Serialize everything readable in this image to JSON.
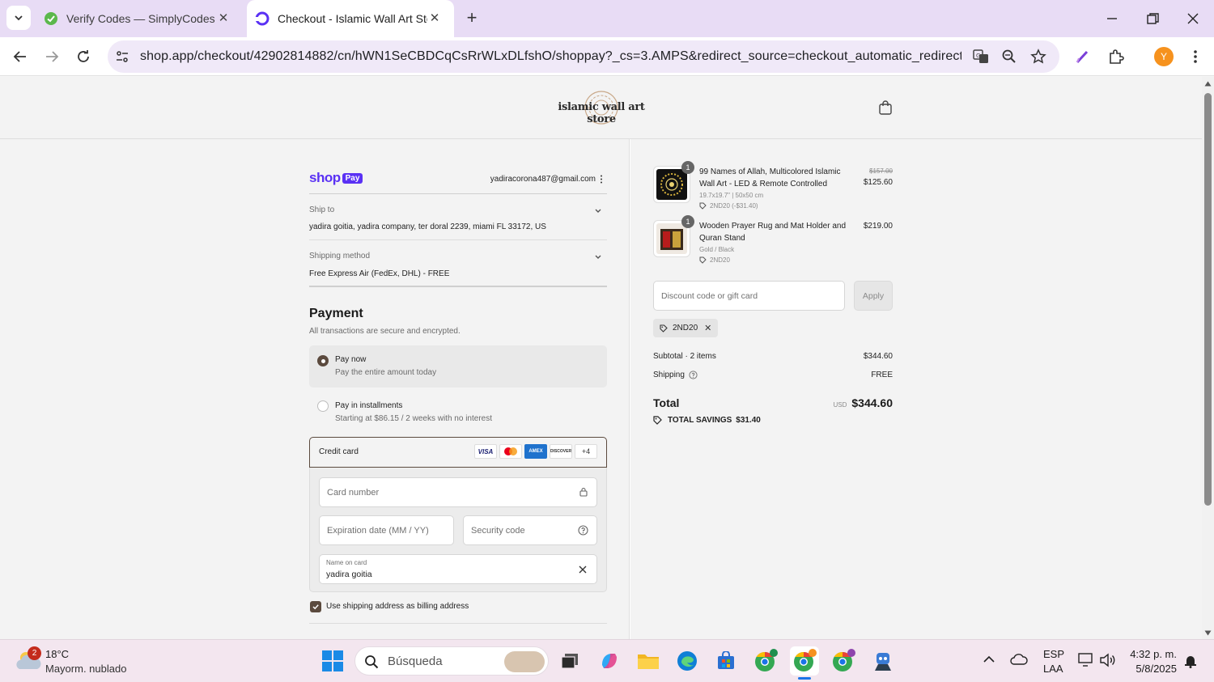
{
  "browser": {
    "tabs": [
      {
        "title": "Verify Codes — SimplyCodes",
        "active": false
      },
      {
        "title": "Checkout - Islamic Wall Art Stor",
        "active": true
      }
    ],
    "url": "shop.app/checkout/42902814882/cn/hWN1SeCBDCqCsRrWLxDLfshO/shoppay?_cs=3.AMPS&redirect_source=checkout_automatic_redirect&trackin...",
    "profile_initial": "Y",
    "accent": "#e8dcf5"
  },
  "store": {
    "logo_text": "islamic wall art store"
  },
  "checkout": {
    "shop_logo": "shop",
    "shop_pay_badge": "Pay",
    "email": "yadiracorona487@gmail.com",
    "ship_to_label": "Ship to",
    "ship_to_value": "yadira goitia, yadira company, ter doral 2239, miami FL 33172, US",
    "shipping_method_label": "Shipping method",
    "shipping_method_value": "Free Express Air (FedEx, DHL) - FREE",
    "payment_title": "Payment",
    "payment_subtitle": "All transactions are secure and encrypted.",
    "pay_now_title": "Pay now",
    "pay_now_sub": "Pay the entire amount today",
    "installments_title": "Pay in installments",
    "installments_sub": "Starting at $86.15 / 2 weeks with no interest",
    "credit_card_label": "Credit card",
    "card_brands": [
      "VISA",
      "mastercard",
      "AMEX",
      "DISCOVER"
    ],
    "more_brands": "+4",
    "card_number_placeholder": "Card number",
    "expiration_placeholder": "Expiration date (MM / YY)",
    "security_placeholder": "Security code",
    "name_on_card_label": "Name on card",
    "name_on_card_value": "yadira goitia",
    "billing_checkbox_label": "Use shipping address as billing address"
  },
  "summary": {
    "items": [
      {
        "qty": "1",
        "name": "99 Names of Allah, Multicolored Islamic Wall Art - LED & Remote Controlled",
        "variant": "19.7x19.7\" | 50x50 cm",
        "discount": "2ND20 (-$31.40)",
        "old_price": "$157.00",
        "price": "$125.60"
      },
      {
        "qty": "1",
        "name": "Wooden Prayer Rug and Mat Holder and Quran Stand",
        "variant": "Gold / Black",
        "discount": "2ND20",
        "old_price": "",
        "price": "$219.00"
      }
    ],
    "discount_placeholder": "Discount code or gift card",
    "apply_label": "Apply",
    "applied_code": "2ND20",
    "subtotal_label": "Subtotal · 2 items",
    "subtotal_value": "$344.60",
    "shipping_label": "Shipping",
    "shipping_value": "FREE",
    "total_label": "Total",
    "currency": "USD",
    "total_value": "$344.60",
    "savings_label": "TOTAL SAVINGS",
    "savings_value": "$31.40"
  },
  "taskbar": {
    "weather_badge": "2",
    "temperature": "18°C",
    "weather_desc": "Mayorm. nublado",
    "search_placeholder": "Búsqueda",
    "lang_top": "ESP",
    "lang_bottom": "LAA",
    "time": "4:32 p. m.",
    "date": "5/8/2025"
  }
}
